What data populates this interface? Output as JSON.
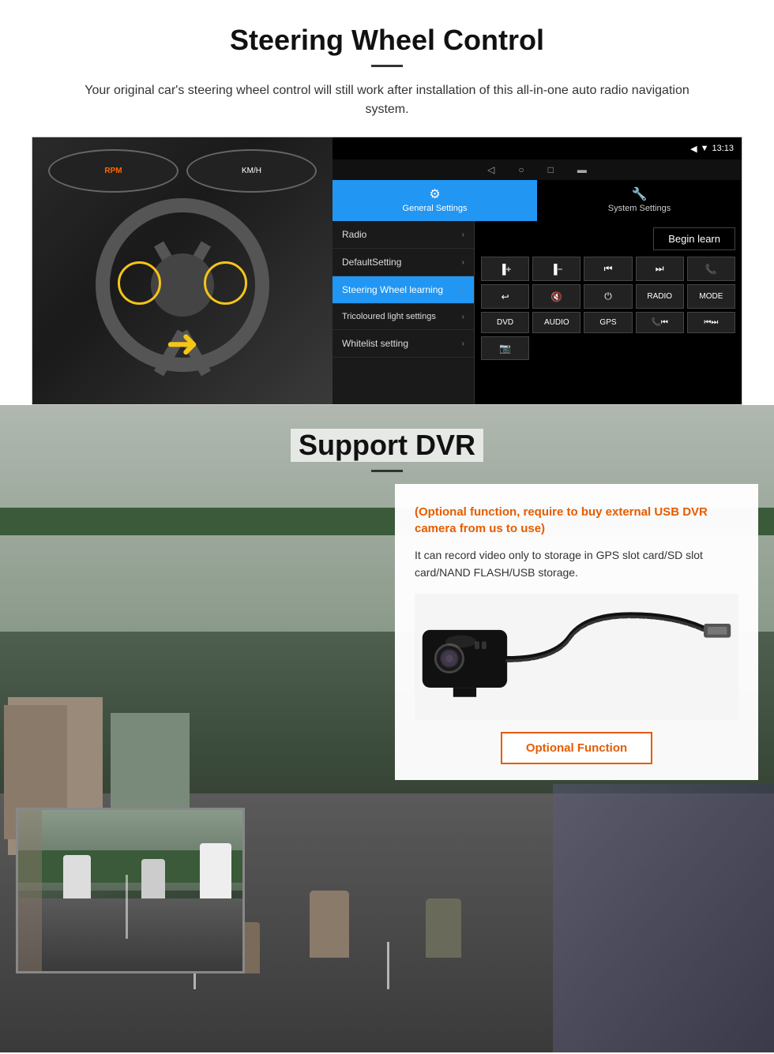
{
  "steering": {
    "title": "Steering Wheel Control",
    "subtitle": "Your original car's steering wheel control will still work after installation of this all-in-one auto radio navigation system.",
    "statusbar": {
      "time": "13:13",
      "icons": "▼ ◀"
    },
    "tabs": [
      {
        "id": "general",
        "icon": "⚙",
        "label": "General Settings",
        "active": true
      },
      {
        "id": "system",
        "icon": "🔧",
        "label": "System Settings",
        "active": false
      }
    ],
    "menu_items": [
      {
        "label": "Radio",
        "active": false
      },
      {
        "label": "DefaultSetting",
        "active": false
      },
      {
        "label": "Steering Wheel learning",
        "active": true
      },
      {
        "label": "Tricoloured light settings",
        "active": false
      },
      {
        "label": "Whitelist setting",
        "active": false
      }
    ],
    "begin_learn_label": "Begin learn",
    "control_buttons": [
      [
        "▐+",
        "▐−",
        "⏮",
        "⏭",
        "📞"
      ],
      [
        "↩",
        "🔇",
        "⏻",
        "RADIO",
        "MODE"
      ],
      [
        "DVD",
        "AUDIO",
        "GPS",
        "📞⏮",
        "⏮⏭"
      ],
      [
        "📷"
      ]
    ]
  },
  "dvr": {
    "title": "Support DVR",
    "card": {
      "title": "(Optional function, require to buy external USB DVR camera from us to use)",
      "body": "It can record video only to storage in GPS slot card/SD slot card/NAND FLASH/USB storage.",
      "optional_btn": "Optional Function"
    }
  }
}
